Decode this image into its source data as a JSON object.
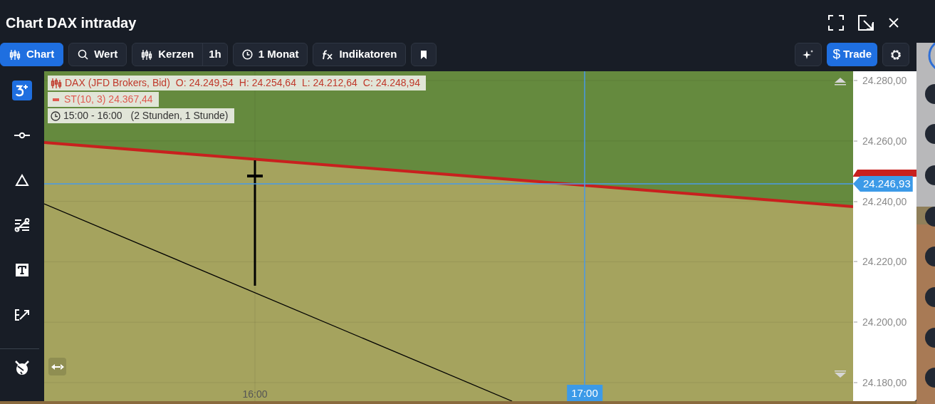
{
  "window": {
    "title": "Chart DAX intraday"
  },
  "toolbar": {
    "left": [
      {
        "kind": "chart",
        "label": "Chart",
        "selected": true
      },
      {
        "kind": "search",
        "label": "Wert",
        "selected": false
      },
      {
        "kind": "candles",
        "label": "Kerzen",
        "selected": false,
        "suffix": "1h"
      },
      {
        "kind": "clock",
        "label": "1 Monat",
        "selected": false
      },
      {
        "kind": "fx",
        "label": "Indikatoren",
        "selected": false
      },
      {
        "kind": "bookmark",
        "selected": false
      }
    ],
    "right": [
      {
        "kind": "sparkle"
      },
      {
        "kind": "trade",
        "icon": "$",
        "label": "Trade"
      },
      {
        "kind": "gear"
      }
    ]
  },
  "tools": [
    {
      "kind": "add",
      "selected": true
    },
    {
      "kind": "line",
      "selected": false
    },
    {
      "kind": "triangle",
      "selected": false
    },
    {
      "kind": "fib",
      "selected": false
    },
    {
      "kind": "text",
      "selected": false
    },
    {
      "kind": "edit",
      "selected": false
    },
    {
      "kind": "bull",
      "selected": false
    }
  ],
  "legend": {
    "instrument": "DAX (JFD Brokers, Bid)",
    "ohlc": [
      "O: 24.249,54",
      "H: 24.254,64",
      "L: 24.212,64",
      "C: 24.248,94"
    ],
    "indicator": "ST(10, 3)",
    "indicator_value": "24.367,44",
    "timespan": "15:00 - 16:00",
    "timespan_note": "(2 Stunden, 1 Stunde)"
  },
  "chart": {
    "price_labels": [
      "24.280,00",
      "24.260,00",
      "24.240,00",
      "24.220,00",
      "24.200,00",
      "24.180,00"
    ],
    "time_labels": [
      {
        "kind": "tick",
        "label": "16:00"
      },
      {
        "kind": "crosshair",
        "label": "17:00"
      }
    ],
    "price_marker": "24.246,93"
  }
}
